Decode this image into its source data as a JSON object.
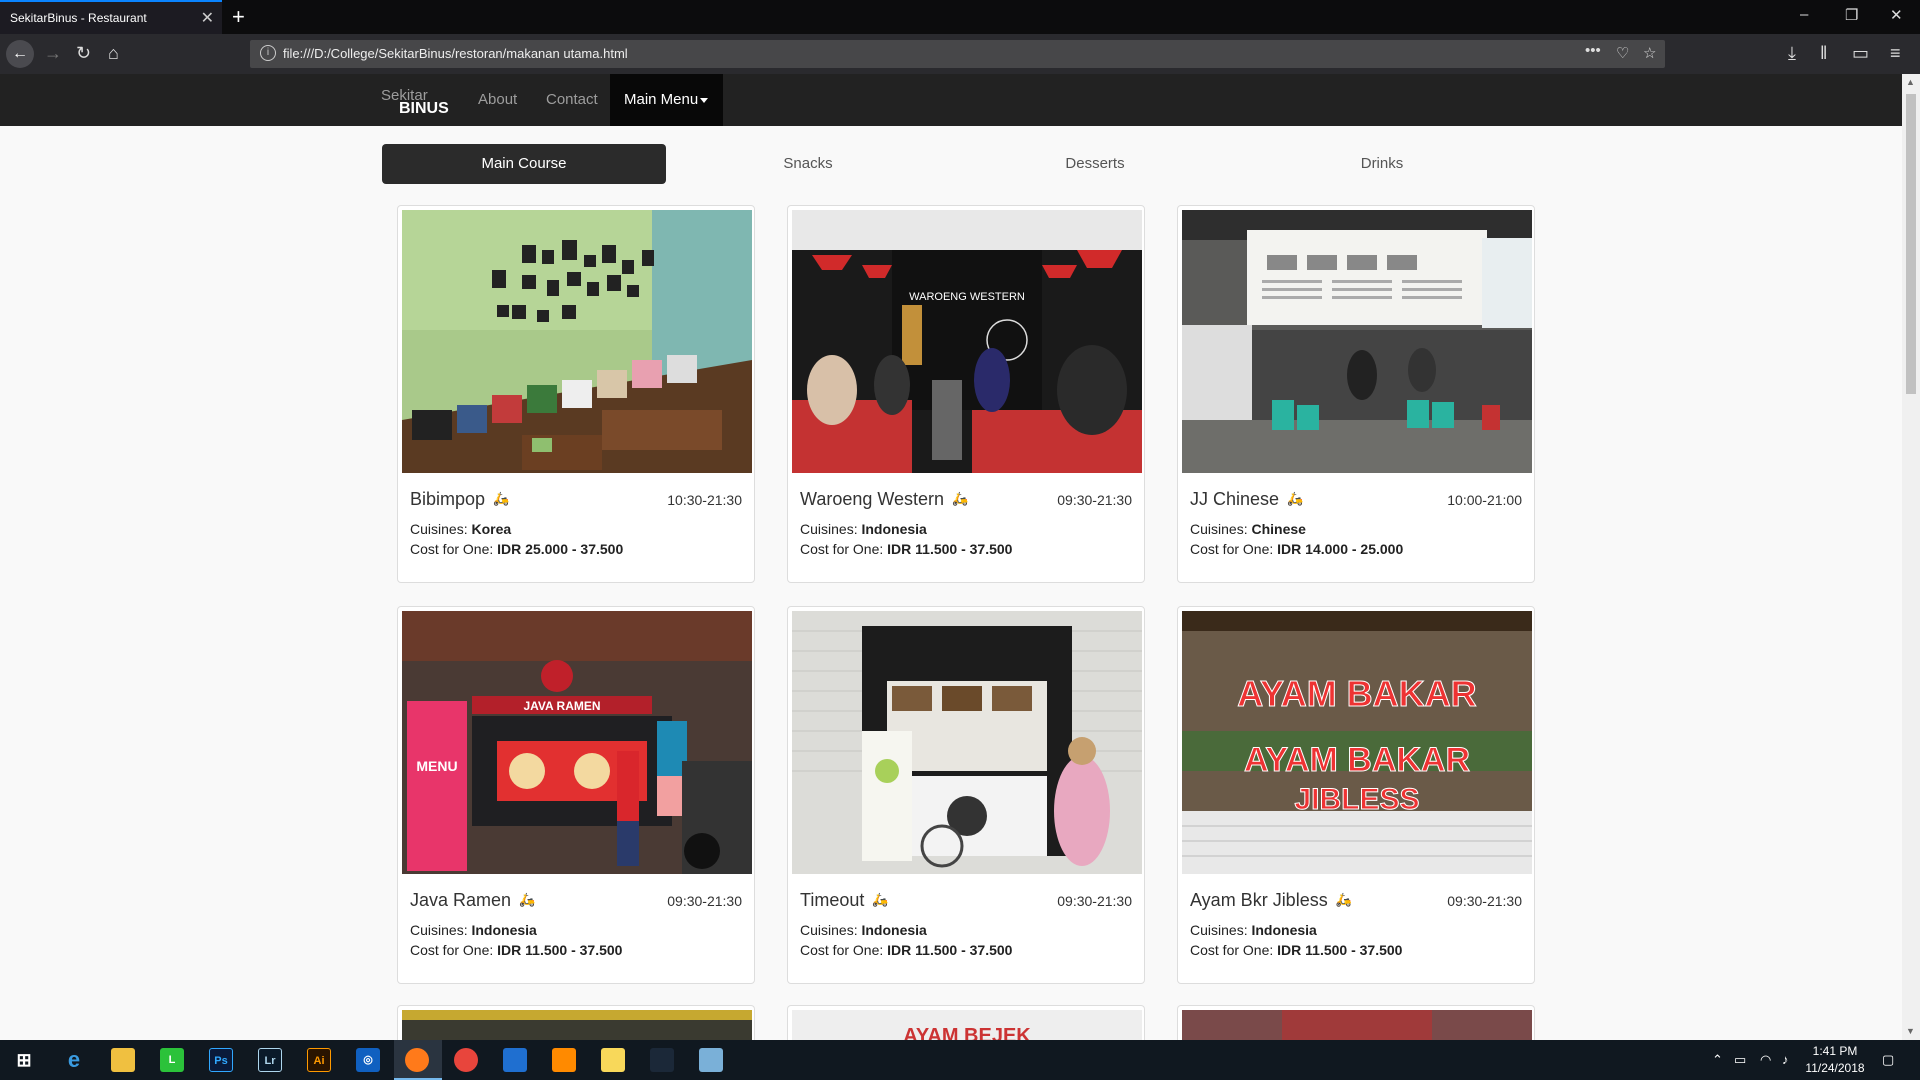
{
  "browser": {
    "tab_title": "SekitarBinus - Restaurant",
    "tab_close": "✕",
    "new_tab": "+",
    "url": "file:///D:/College/SekitarBinus/restoran/makanan utama.html",
    "url_info": "i",
    "page_actions": "•••"
  },
  "site": {
    "brand_top": "Sekitar",
    "brand_bottom": "BINUS",
    "nav": {
      "about": "About",
      "contact": "Contact",
      "main_menu": "Main Menu"
    },
    "categories": [
      "Main Course",
      "Snacks",
      "Desserts",
      "Drinks"
    ],
    "active_category": "Main Course",
    "labels": {
      "cuisines": "Cuisines:",
      "cost": "Cost for One:"
    },
    "restaurants": [
      {
        "name": "Bibimpop",
        "hours": "10:30-21:30",
        "cuisine": "Korea",
        "cost": "IDR 25.000 - 37.500"
      },
      {
        "name": "Waroeng Western",
        "hours": "09:30-21:30",
        "cuisine": "Indonesia",
        "cost": "IDR 11.500 - 37.500"
      },
      {
        "name": "JJ Chinese",
        "hours": "10:00-21:00",
        "cuisine": "Chinese",
        "cost": "IDR 14.000 - 25.000"
      },
      {
        "name": "Java Ramen",
        "hours": "09:30-21:30",
        "cuisine": "Indonesia",
        "cost": "IDR 11.500 - 37.500"
      },
      {
        "name": "Timeout",
        "hours": "09:30-21:30",
        "cuisine": "Indonesia",
        "cost": "IDR 11.500 - 37.500"
      },
      {
        "name": "Ayam Bkr Jibless",
        "hours": "09:30-21:30",
        "cuisine": "Indonesia",
        "cost": "IDR 11.500 - 37.500"
      }
    ],
    "photo_texts": {
      "waroeng": "WAROENG WESTERN",
      "java_ramen_sign": "JAVA RAMEN",
      "java_ramen_menu": "MENU",
      "ayam_top": "AYAM BAKAR",
      "ayam_mid": "AYAM BAKAR",
      "ayam_bot": "JIBLESS",
      "ayam_bejek": "AYAM BEJEK"
    }
  },
  "taskbar": {
    "clock_time": "1:41 PM",
    "clock_date": "11/24/2018"
  },
  "colors": {
    "accent": "#0a84ff",
    "navbar": "#222222",
    "active_tab": "#2b2b2b",
    "delivery_icon": "#d9534f"
  }
}
